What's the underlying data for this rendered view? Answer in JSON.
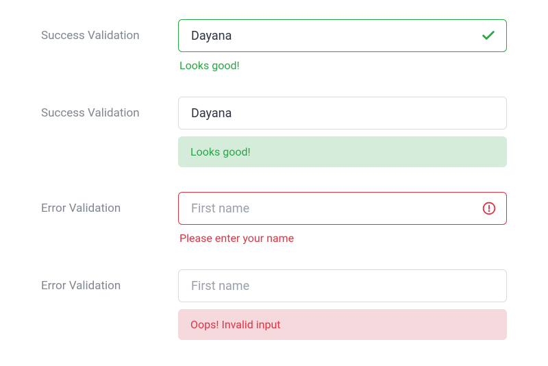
{
  "rows": [
    {
      "label": "Success Validation",
      "value": "Dayana",
      "placeholder": "",
      "feedback": "Looks good!"
    },
    {
      "label": "Success Validation",
      "value": "Dayana",
      "placeholder": "",
      "feedback": "Looks good!"
    },
    {
      "label": "Error Validation",
      "value": "",
      "placeholder": "First name",
      "feedback": "Please enter your name"
    },
    {
      "label": "Error Validation",
      "value": "",
      "placeholder": "First name",
      "feedback": "Oops! Invalid input"
    }
  ],
  "colors": {
    "success": "#28a745",
    "error": "#dc3545"
  }
}
